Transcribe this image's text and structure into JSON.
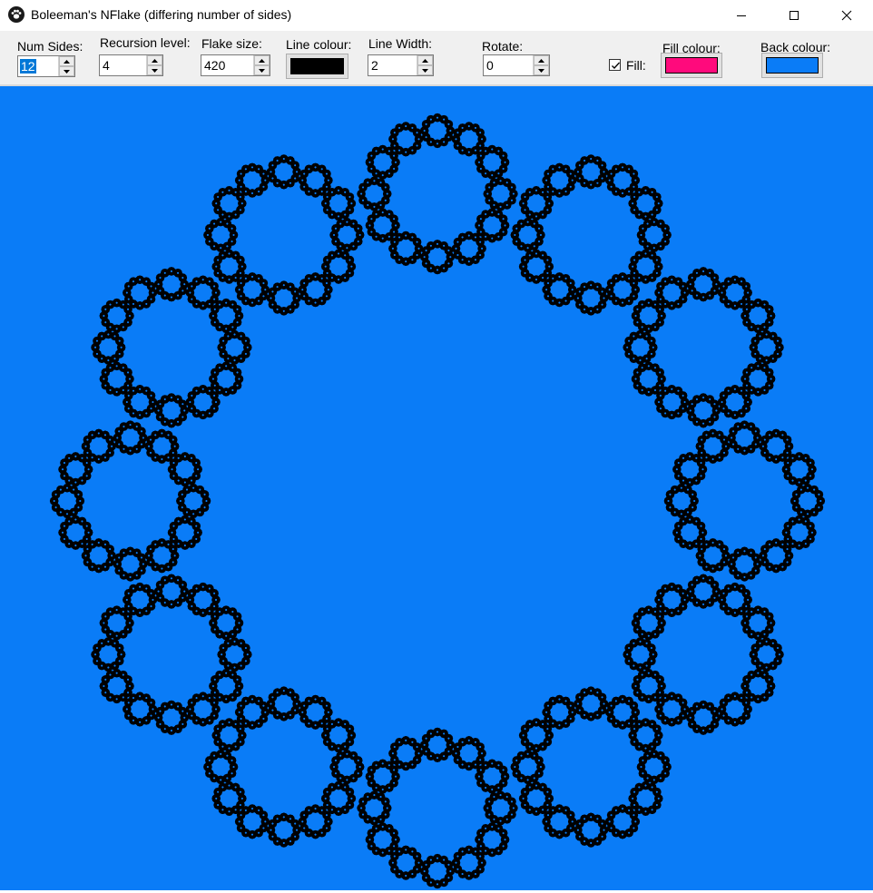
{
  "window": {
    "title": "Boleeman's NFlake (differing number of sides)"
  },
  "toolbar": {
    "num_sides": {
      "label": "Num Sides:",
      "value": "12"
    },
    "recursion": {
      "label": "Recursion level:",
      "value": "4"
    },
    "flake_size": {
      "label": "Flake size:",
      "value": "420"
    },
    "line_colour": {
      "label": "Line colour:",
      "color": "#000000"
    },
    "line_width": {
      "label": "Line Width:",
      "value": "2"
    },
    "rotate": {
      "label": "Rotate:",
      "value": "0"
    },
    "fill": {
      "label": "Fill:",
      "checked": true
    },
    "fill_colour": {
      "label": "Fill colour:",
      "color": "#ff0a7c"
    },
    "back_colour": {
      "label": "Back colour:",
      "color": "#0a7cf7"
    }
  },
  "canvas": {
    "background": "#0a7cf7",
    "fill": "#ff0a7c",
    "stroke": "#000000",
    "sides": 12,
    "recursion": 4
  }
}
